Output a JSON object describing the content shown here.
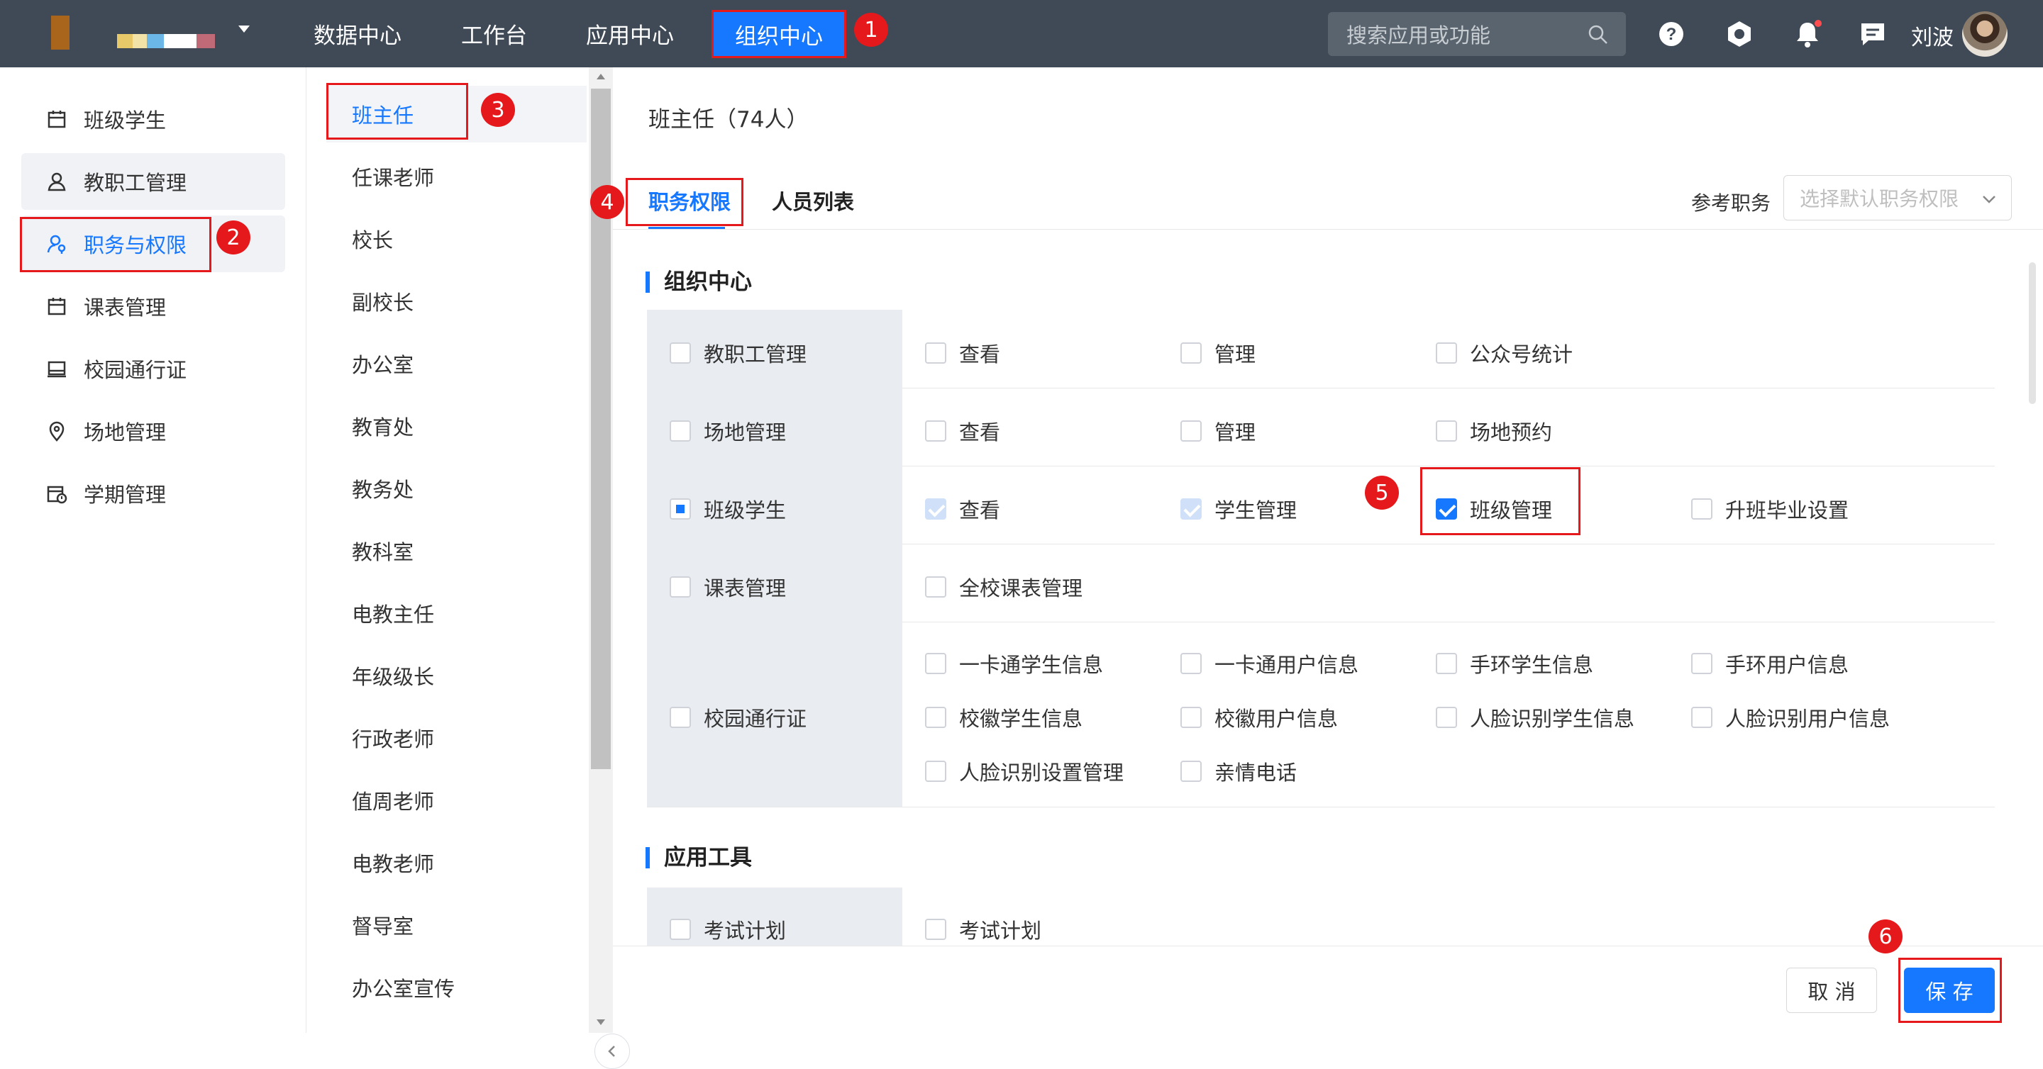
{
  "topbar": {
    "nav": [
      "数据中心",
      "工作台",
      "应用中心"
    ],
    "nav_active": "组织中心",
    "search_placeholder": "搜索应用或功能",
    "user_name": "刘波"
  },
  "sidebar": {
    "items": [
      {
        "label": "班级学生",
        "icon": "calendar-grid-icon"
      },
      {
        "label": "教职工管理",
        "icon": "user-icon"
      },
      {
        "label": "职务与权限",
        "icon": "user-key-icon"
      },
      {
        "label": "课表管理",
        "icon": "calendar-icon"
      },
      {
        "label": "校园通行证",
        "icon": "card-icon"
      },
      {
        "label": "场地管理",
        "icon": "location-icon"
      },
      {
        "label": "学期管理",
        "icon": "calendar-clock-icon"
      }
    ]
  },
  "roles": [
    "班主任",
    "任课老师",
    "校长",
    "副校长",
    "办公室",
    "教育处",
    "教务处",
    "教科室",
    "电教主任",
    "年级级长",
    "行政老师",
    "值周老师",
    "电教老师",
    "督导室",
    "办公室宣传"
  ],
  "main": {
    "title": "班主任（74人）",
    "tabs": [
      "职务权限",
      "人员列表"
    ],
    "ref_label": "参考职务",
    "ref_placeholder": "选择默认职务权限",
    "sections": [
      {
        "title": "组织中心",
        "rows": [
          {
            "name": "教职工管理",
            "state": "unchecked",
            "perms": [
              {
                "label": "查看",
                "state": "unchecked"
              },
              {
                "label": "管理",
                "state": "unchecked"
              },
              {
                "label": "公众号统计",
                "state": "unchecked"
              }
            ]
          },
          {
            "name": "场地管理",
            "state": "unchecked",
            "perms": [
              {
                "label": "查看",
                "state": "unchecked"
              },
              {
                "label": "管理",
                "state": "unchecked"
              },
              {
                "label": "场地预约",
                "state": "unchecked"
              }
            ]
          },
          {
            "name": "班级学生",
            "state": "partial",
            "perms": [
              {
                "label": "查看",
                "state": "disabled"
              },
              {
                "label": "学生管理",
                "state": "disabled"
              },
              {
                "label": "班级管理",
                "state": "checked"
              },
              {
                "label": "升班毕业设置",
                "state": "unchecked"
              }
            ]
          },
          {
            "name": "课表管理",
            "state": "unchecked",
            "perms": [
              {
                "label": "全校课表管理",
                "state": "unchecked"
              }
            ]
          },
          {
            "name": "校园通行证",
            "state": "unchecked",
            "perms": [
              {
                "label": "一卡通学生信息",
                "state": "unchecked"
              },
              {
                "label": "一卡通用户信息",
                "state": "unchecked"
              },
              {
                "label": "手环学生信息",
                "state": "unchecked"
              },
              {
                "label": "手环用户信息",
                "state": "unchecked"
              },
              {
                "label": "校徽学生信息",
                "state": "unchecked"
              },
              {
                "label": "校徽用户信息",
                "state": "unchecked"
              },
              {
                "label": "人脸识别学生信息",
                "state": "unchecked"
              },
              {
                "label": "人脸识别用户信息",
                "state": "unchecked"
              },
              {
                "label": "人脸识别设置管理",
                "state": "unchecked"
              },
              {
                "label": "亲情电话",
                "state": "unchecked"
              }
            ]
          }
        ]
      },
      {
        "title": "应用工具",
        "rows": [
          {
            "name": "考试计划",
            "state": "unchecked",
            "perms": [
              {
                "label": "考试计划",
                "state": "unchecked"
              }
            ]
          }
        ]
      }
    ],
    "cancel_label": "取 消",
    "save_label": "保 存"
  },
  "annotations": [
    "1",
    "2",
    "3",
    "4",
    "5",
    "6"
  ],
  "colors": {
    "topbar": "#3f4a56",
    "accent": "#1677ff",
    "annotation": "#e5191c"
  }
}
